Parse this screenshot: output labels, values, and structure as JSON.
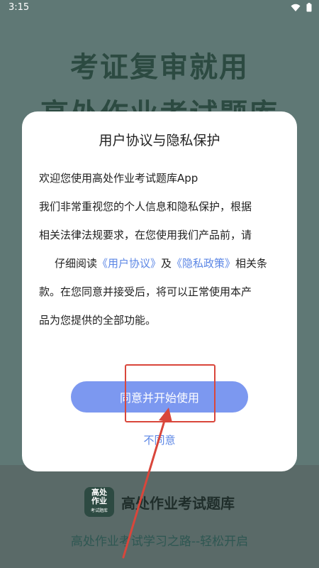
{
  "status_bar": {
    "time": "3:15"
  },
  "background": {
    "headline_1": "考证复审就用",
    "headline_2": "高处作业考试题库",
    "logo": {
      "line1": "高处",
      "line2": "作业",
      "line3": "考试题库"
    },
    "app_name": "高处作业考试题库",
    "slogan": "高处作业考试学习之路--轻松开启"
  },
  "dialog": {
    "title": "用户协议与隐私保护",
    "paragraph_1": "欢迎您使用高处作业考试题库App",
    "paragraph_2": "我们非常重视您的个人信息和隐私保护，根据",
    "paragraph_3": "相关法律法规要求，在您使用我们产品前，请",
    "paragraph_4_prefix": "仔细阅读",
    "user_agreement_link": "《用户协议》",
    "and": "及",
    "privacy_policy_link": "《隐私政策》",
    "paragraph_4_suffix": "相关条",
    "paragraph_5": "款。在您同意并接受后，将可以正常使用本产",
    "paragraph_6": "品为您提供的全部功能。",
    "agree_button": "同意并开始使用",
    "disagree_button": "不同意"
  },
  "colors": {
    "accent": "#7c98f0",
    "link": "#5b86e5",
    "annotation": "#d9463b"
  }
}
